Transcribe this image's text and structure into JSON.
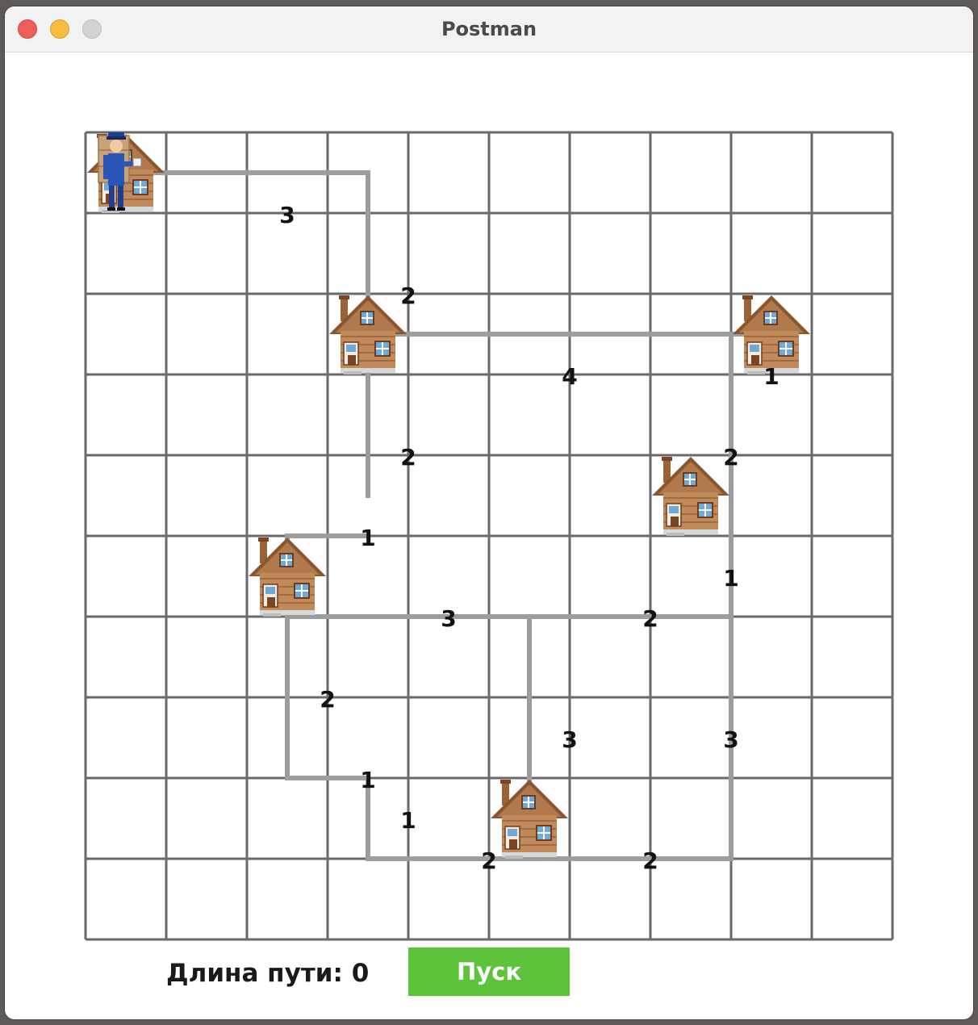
{
  "window": {
    "title": "Postman"
  },
  "status": {
    "label": "Длина пути:",
    "value": "0"
  },
  "controls": {
    "start_label": "Пуск"
  },
  "board": {
    "cols": 10,
    "rows": 10,
    "postman": {
      "col": 0,
      "row": 0
    },
    "houses": [
      {
        "col": 0,
        "row": 0
      },
      {
        "col": 3,
        "row": 2
      },
      {
        "col": 8,
        "row": 2
      },
      {
        "col": 7,
        "row": 4
      },
      {
        "col": 2,
        "row": 5
      },
      {
        "col": 5,
        "row": 8
      }
    ],
    "roads": [
      {
        "weight": "3",
        "path": [
          [
            0,
            0
          ],
          [
            3,
            0
          ],
          [
            3,
            2
          ]
        ]
      },
      {
        "weight": "2",
        "path": [
          [
            3,
            0
          ],
          [
            3,
            2
          ]
        ]
      },
      {
        "weight": "4",
        "path": [
          [
            3,
            2
          ],
          [
            8,
            2
          ]
        ]
      },
      {
        "weight": "1",
        "path": [
          [
            7.5,
            2
          ],
          [
            8,
            2
          ]
        ]
      },
      {
        "weight": "2",
        "path": [
          [
            7.5,
            2
          ],
          [
            7.5,
            4
          ]
        ]
      },
      {
        "weight": "2",
        "path": [
          [
            3,
            2
          ],
          [
            3,
            4
          ]
        ]
      },
      {
        "weight": "1",
        "path": [
          [
            3,
            4.5
          ],
          [
            2,
            4.5
          ],
          [
            2,
            5
          ]
        ]
      },
      {
        "weight": "1",
        "path": [
          [
            7.5,
            4
          ],
          [
            7.5,
            5.5
          ]
        ]
      },
      {
        "weight": "3",
        "path": [
          [
            2,
            5.5
          ],
          [
            5,
            5.5
          ]
        ]
      },
      {
        "weight": "2",
        "path": [
          [
            5,
            5.5
          ],
          [
            7.5,
            5.5
          ]
        ]
      },
      {
        "weight": "3",
        "path": [
          [
            5,
            5.5
          ],
          [
            5,
            8
          ]
        ]
      },
      {
        "weight": "3",
        "path": [
          [
            7.5,
            5.5
          ],
          [
            7.5,
            8.5
          ]
        ]
      },
      {
        "weight": "2",
        "path": [
          [
            2,
            5
          ],
          [
            2,
            7.5
          ]
        ]
      },
      {
        "weight": "1",
        "path": [
          [
            2,
            7.5
          ],
          [
            3,
            7.5
          ]
        ]
      },
      {
        "weight": "1",
        "path": [
          [
            3,
            7.5
          ],
          [
            3,
            8.5
          ]
        ]
      },
      {
        "weight": "2",
        "path": [
          [
            3,
            8.5
          ],
          [
            5,
            8.5
          ]
        ]
      },
      {
        "weight": "2",
        "path": [
          [
            5,
            8.5
          ],
          [
            7.5,
            8.5
          ]
        ]
      }
    ],
    "weight_labels": [
      {
        "text": "3",
        "col": 2,
        "row": 0.5
      },
      {
        "text": "2",
        "col": 3.5,
        "row": 1.5
      },
      {
        "text": "4",
        "col": 5.5,
        "row": 2.5
      },
      {
        "text": "1",
        "col": 8,
        "row": 2.5
      },
      {
        "text": "2",
        "col": 7.5,
        "row": 3.5
      },
      {
        "text": "2",
        "col": 3.5,
        "row": 3.5
      },
      {
        "text": "1",
        "col": 3,
        "row": 4.5
      },
      {
        "text": "1",
        "col": 7.5,
        "row": 5
      },
      {
        "text": "3",
        "col": 4,
        "row": 5.5
      },
      {
        "text": "2",
        "col": 6.5,
        "row": 5.5
      },
      {
        "text": "2",
        "col": 2.5,
        "row": 6.5
      },
      {
        "text": "3",
        "col": 5.5,
        "row": 7
      },
      {
        "text": "3",
        "col": 7.5,
        "row": 7
      },
      {
        "text": "1",
        "col": 3,
        "row": 7.5
      },
      {
        "text": "1",
        "col": 3.5,
        "row": 8
      },
      {
        "text": "2",
        "col": 4.5,
        "row": 8.5
      },
      {
        "text": "2",
        "col": 6.5,
        "row": 8.5
      }
    ]
  }
}
